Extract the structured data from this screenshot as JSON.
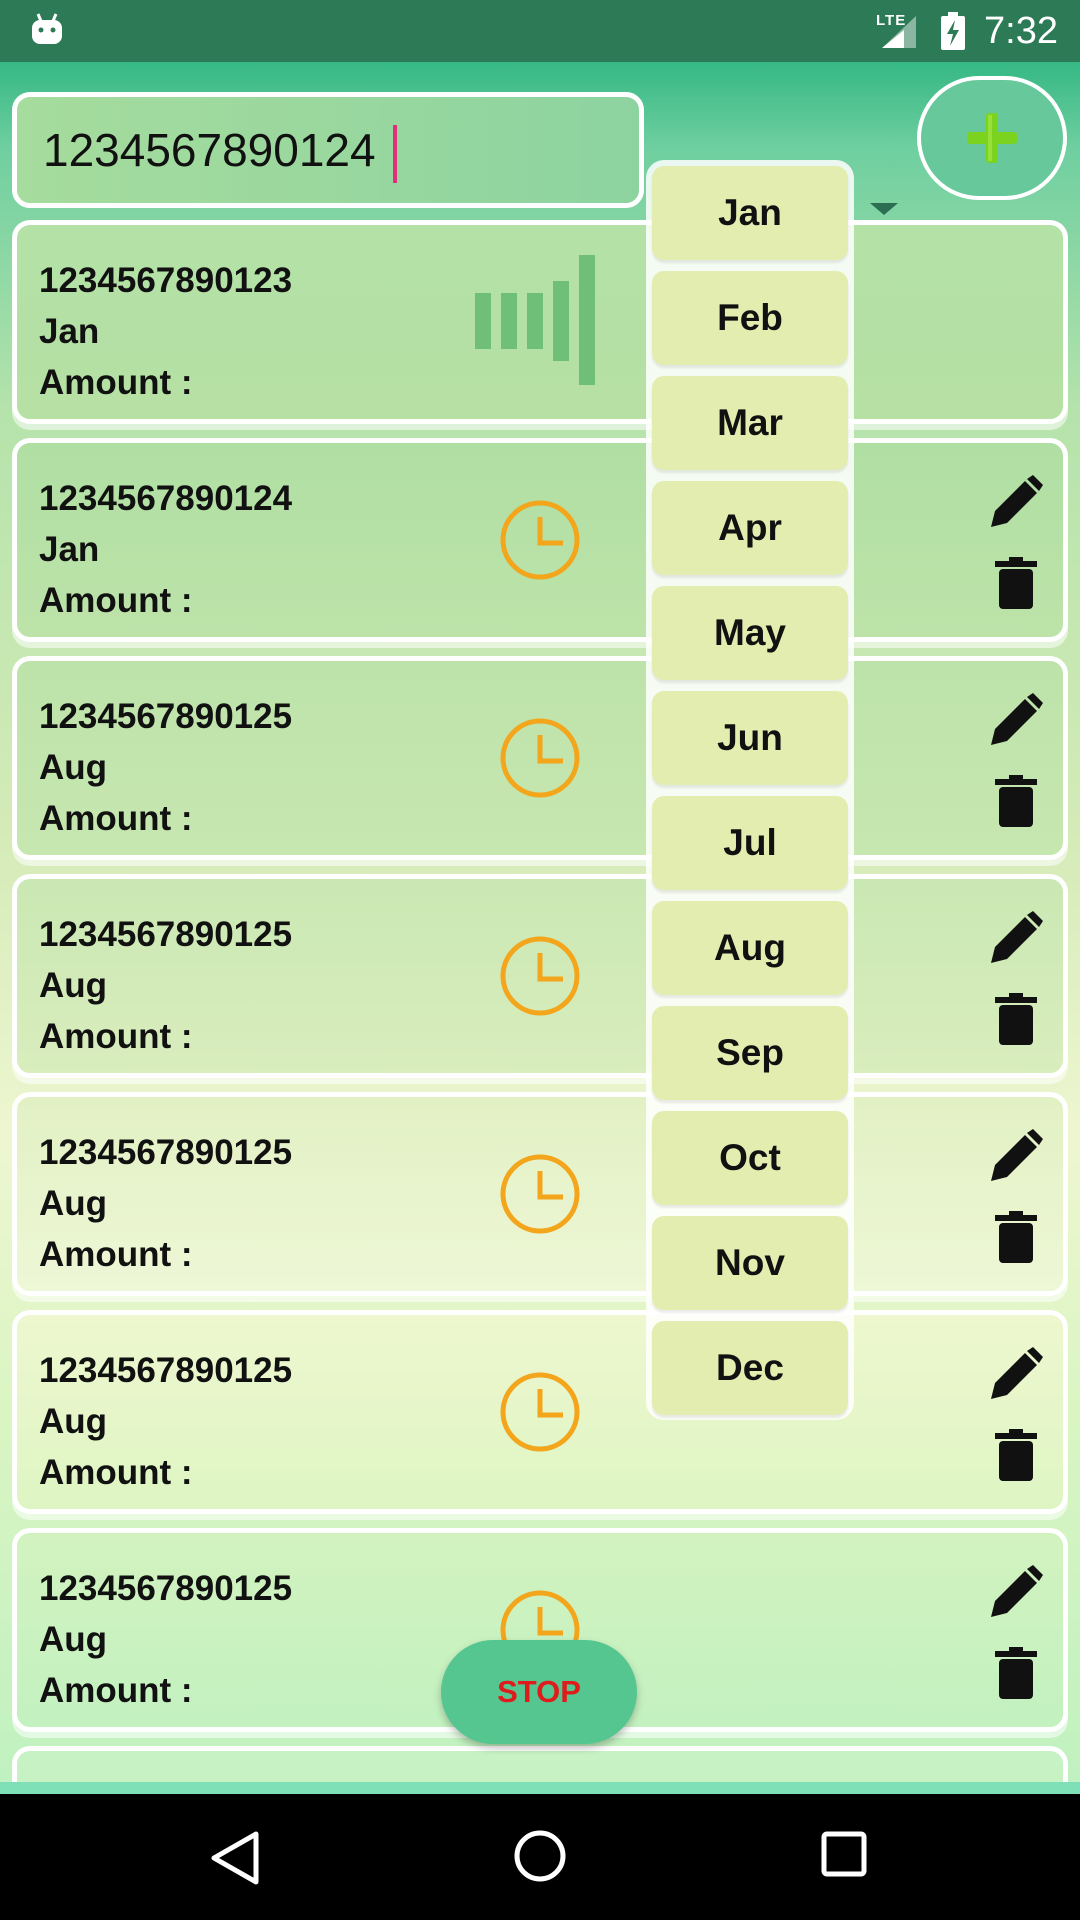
{
  "status_bar": {
    "network": "LTE",
    "time": "7:32",
    "icons": [
      "android-icon",
      "signal-icon",
      "battery-charging-icon"
    ]
  },
  "search": {
    "value": "1234567890124",
    "placeholder": ""
  },
  "month_select": {
    "options": [
      "Jan",
      "Feb",
      "Mar",
      "Apr",
      "May",
      "Jun",
      "Jul",
      "Aug",
      "Sep",
      "Oct",
      "Nov",
      "Dec"
    ]
  },
  "add_button": {
    "icon": "plus-icon",
    "color": "#7bd31f"
  },
  "records": [
    {
      "number": "1234567890123",
      "month": "Jan",
      "amount_label": "Amount :",
      "status_icon": "bars-icon"
    },
    {
      "number": "1234567890124",
      "month": "Jan",
      "amount_label": "Amount :",
      "status_icon": "clock-icon"
    },
    {
      "number": "1234567890125",
      "month": "Aug",
      "amount_label": "Amount :",
      "status_icon": "clock-icon"
    },
    {
      "number": "1234567890125",
      "month": "Aug",
      "amount_label": "Amount :",
      "status_icon": "clock-icon"
    },
    {
      "number": "1234567890125",
      "month": "Aug",
      "amount_label": "Amount :",
      "status_icon": "clock-icon"
    },
    {
      "number": "1234567890125",
      "month": "Aug",
      "amount_label": "Amount :",
      "status_icon": "clock-icon"
    },
    {
      "number": "1234567890125",
      "month": "Aug",
      "amount_label": "Amount :",
      "status_icon": "clock-icon"
    }
  ],
  "stop_button": {
    "label": "STOP",
    "color": "#e01b1b"
  },
  "colors": {
    "status_bar": "#2c7a56",
    "clock_icon": "#f3a51b",
    "accent_green": "#35b884"
  },
  "nav_bar": {
    "icons": [
      "back-icon",
      "home-icon",
      "recents-icon"
    ]
  }
}
